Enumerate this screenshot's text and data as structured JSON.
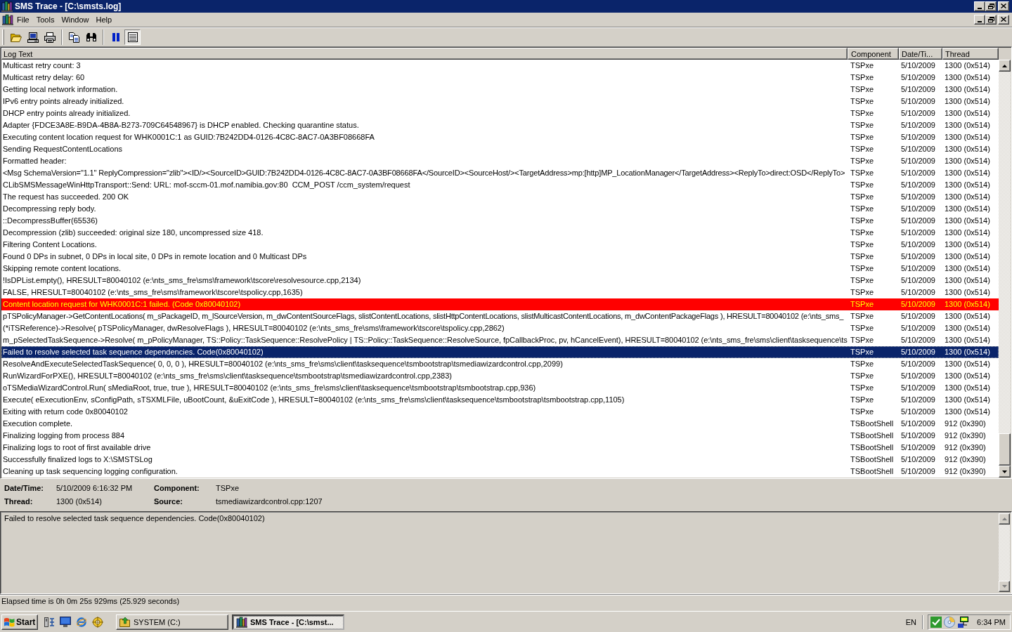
{
  "window": {
    "title": "SMS Trace - [C:\\smsts.log]"
  },
  "menu_bar": {
    "items": [
      "File",
      "Tools",
      "Window",
      "Help"
    ]
  },
  "toolbar": {
    "groups": [
      {
        "buttons": [
          {
            "kind": "open",
            "pressed": false
          },
          {
            "kind": "computer",
            "pressed": false
          },
          {
            "kind": "print",
            "pressed": false
          }
        ]
      },
      {
        "buttons": [
          {
            "kind": "copy",
            "pressed": false
          },
          {
            "kind": "find",
            "pressed": false
          }
        ]
      },
      {
        "buttons": [
          {
            "kind": "pause",
            "pressed": false
          },
          {
            "kind": "list",
            "pressed": true
          }
        ]
      }
    ]
  },
  "log_table": {
    "columns": [
      "Log Text",
      "Component",
      "Date/Ti...",
      "Thread"
    ],
    "rows": [
      {
        "kind": "info",
        "selected": false,
        "log_text": "Multicast retry count: 3",
        "component": "TSPxe",
        "date_time": "5/10/2009",
        "thread": "1300 (0x514)"
      },
      {
        "kind": "info",
        "selected": false,
        "log_text": "Multicast retry delay: 60",
        "component": "TSPxe",
        "date_time": "5/10/2009",
        "thread": "1300 (0x514)"
      },
      {
        "kind": "info",
        "selected": false,
        "log_text": "Getting local network information.",
        "component": "TSPxe",
        "date_time": "5/10/2009",
        "thread": "1300 (0x514)"
      },
      {
        "kind": "info",
        "selected": false,
        "log_text": "IPv6 entry points already initialized.",
        "component": "TSPxe",
        "date_time": "5/10/2009",
        "thread": "1300 (0x514)"
      },
      {
        "kind": "info",
        "selected": false,
        "log_text": "DHCP entry points already initialized.",
        "component": "TSPxe",
        "date_time": "5/10/2009",
        "thread": "1300 (0x514)"
      },
      {
        "kind": "info",
        "selected": false,
        "log_text": "Adapter {FDCE3A8E-B9DA-4B8A-B273-709C64548967} is DHCP enabled. Checking quarantine status.",
        "component": "TSPxe",
        "date_time": "5/10/2009",
        "thread": "1300 (0x514)"
      },
      {
        "kind": "info",
        "selected": false,
        "log_text": "Executing content location request for WHK0001C:1 as GUID:7B242DD4-0126-4C8C-8AC7-0A3BF08668FA",
        "component": "TSPxe",
        "date_time": "5/10/2009",
        "thread": "1300 (0x514)"
      },
      {
        "kind": "info",
        "selected": false,
        "log_text": "Sending RequestContentLocations",
        "component": "TSPxe",
        "date_time": "5/10/2009",
        "thread": "1300 (0x514)"
      },
      {
        "kind": "info",
        "selected": false,
        "log_text": "Formatted header:",
        "component": "TSPxe",
        "date_time": "5/10/2009",
        "thread": "1300 (0x514)"
      },
      {
        "kind": "info",
        "selected": false,
        "log_text": "<Msg SchemaVersion=\"1.1\" ReplyCompression=\"zlib\"><ID/><SourceID>GUID:7B242DD4-0126-4C8C-8AC7-0A3BF08668FA</SourceID><SourceHost/><TargetAddress>mp:[http]MP_LocationManager</TargetAddress><ReplyTo>direct:OSD</ReplyTo>",
        "component": "TSPxe",
        "date_time": "5/10/2009",
        "thread": "1300 (0x514)"
      },
      {
        "kind": "info",
        "selected": false,
        "log_text": "CLibSMSMessageWinHttpTransport::Send: URL: mof-sccm-01.mof.namibia.gov:80  CCM_POST /ccm_system/request",
        "component": "TSPxe",
        "date_time": "5/10/2009",
        "thread": "1300 (0x514)"
      },
      {
        "kind": "info",
        "selected": false,
        "log_text": "The request has succeeded. 200 OK",
        "component": "TSPxe",
        "date_time": "5/10/2009",
        "thread": "1300 (0x514)"
      },
      {
        "kind": "info",
        "selected": false,
        "log_text": "Decompressing reply body.",
        "component": "TSPxe",
        "date_time": "5/10/2009",
        "thread": "1300 (0x514)"
      },
      {
        "kind": "info",
        "selected": false,
        "log_text": "::DecompressBuffer(65536)",
        "component": "TSPxe",
        "date_time": "5/10/2009",
        "thread": "1300 (0x514)"
      },
      {
        "kind": "info",
        "selected": false,
        "log_text": "Decompression (zlib) succeeded: original size 180, uncompressed size 418.",
        "component": "TSPxe",
        "date_time": "5/10/2009",
        "thread": "1300 (0x514)"
      },
      {
        "kind": "info",
        "selected": false,
        "log_text": "Filtering Content Locations.",
        "component": "TSPxe",
        "date_time": "5/10/2009",
        "thread": "1300 (0x514)"
      },
      {
        "kind": "info",
        "selected": false,
        "log_text": "Found 0 DPs in subnet, 0 DPs in local site, 0 DPs in remote location and 0 Multicast DPs",
        "component": "TSPxe",
        "date_time": "5/10/2009",
        "thread": "1300 (0x514)"
      },
      {
        "kind": "info",
        "selected": false,
        "log_text": "Skipping remote content locations.",
        "component": "TSPxe",
        "date_time": "5/10/2009",
        "thread": "1300 (0x514)"
      },
      {
        "kind": "info",
        "selected": false,
        "log_text": "!IsDPList.empty(), HRESULT=80040102 (e:\\nts_sms_fre\\sms\\framework\\tscore\\resolvesource.cpp,2134)",
        "component": "TSPxe",
        "date_time": "5/10/2009",
        "thread": "1300 (0x514)"
      },
      {
        "kind": "info",
        "selected": false,
        "log_text": "FALSE, HRESULT=80040102 (e:\\nts_sms_fre\\sms\\framework\\tscore\\tspolicy.cpp,1635)",
        "component": "TSPxe",
        "date_time": "5/10/2009",
        "thread": "1300 (0x514)"
      },
      {
        "kind": "error",
        "selected": false,
        "log_text": "Content location request for WHK0001C:1 failed. (Code 0x80040102)",
        "component": "TSPxe",
        "date_time": "5/10/2009",
        "thread": "1300 (0x514)"
      },
      {
        "kind": "info",
        "selected": false,
        "log_text": "pTSPolicyManager->GetContentLocations( m_sPackageID, m_lSourceVersion, m_dwContentSourceFlags, slistContentLocations, slistHttpContentLocations, slistMulticastContentLocations, m_dwContentPackageFlags ), HRESULT=80040102 (e:\\nts_sms_",
        "component": "TSPxe",
        "date_time": "5/10/2009",
        "thread": "1300 (0x514)"
      },
      {
        "kind": "info",
        "selected": false,
        "log_text": "(*iTSReference)->Resolve( pTSPolicyManager, dwResolveFlags ), HRESULT=80040102 (e:\\nts_sms_fre\\sms\\framework\\tscore\\tspolicy.cpp,2862)",
        "component": "TSPxe",
        "date_time": "5/10/2009",
        "thread": "1300 (0x514)"
      },
      {
        "kind": "info",
        "selected": false,
        "log_text": "m_pSelectedTaskSequence->Resolve( m_pPolicyManager, TS::Policy::TaskSequence::ResolvePolicy | TS::Policy::TaskSequence::ResolveSource, fpCallbackProc, pv, hCancelEvent), HRESULT=80040102 (e:\\nts_sms_fre\\sms\\client\\tasksequence\\ts",
        "component": "TSPxe",
        "date_time": "5/10/2009",
        "thread": "1300 (0x514)"
      },
      {
        "kind": "info",
        "selected": true,
        "log_text": "Failed to resolve selected task sequence dependencies. Code(0x80040102)",
        "component": "TSPxe",
        "date_time": "5/10/2009",
        "thread": "1300 (0x514)"
      },
      {
        "kind": "info",
        "selected": false,
        "log_text": "ResolveAndExecuteSelectedTaskSequence( 0, 0, 0 ), HRESULT=80040102 (e:\\nts_sms_fre\\sms\\client\\tasksequence\\tsmbootstrap\\tsmediawizardcontrol.cpp,2099)",
        "component": "TSPxe",
        "date_time": "5/10/2009",
        "thread": "1300 (0x514)"
      },
      {
        "kind": "info",
        "selected": false,
        "log_text": "RunWizardForPXE(), HRESULT=80040102 (e:\\nts_sms_fre\\sms\\client\\tasksequence\\tsmbootstrap\\tsmediawizardcontrol.cpp,2383)",
        "component": "TSPxe",
        "date_time": "5/10/2009",
        "thread": "1300 (0x514)"
      },
      {
        "kind": "info",
        "selected": false,
        "log_text": "oTSMediaWizardControl.Run( sMediaRoot, true, true ), HRESULT=80040102 (e:\\nts_sms_fre\\sms\\client\\tasksequence\\tsmbootstrap\\tsmbootstrap.cpp,936)",
        "component": "TSPxe",
        "date_time": "5/10/2009",
        "thread": "1300 (0x514)"
      },
      {
        "kind": "info",
        "selected": false,
        "log_text": "Execute( eExecutionEnv, sConfigPath, sTSXMLFile, uBootCount, &uExitCode ), HRESULT=80040102 (e:\\nts_sms_fre\\sms\\client\\tasksequence\\tsmbootstrap\\tsmbootstrap.cpp,1105)",
        "component": "TSPxe",
        "date_time": "5/10/2009",
        "thread": "1300 (0x514)"
      },
      {
        "kind": "info",
        "selected": false,
        "log_text": "Exiting with return code 0x80040102",
        "component": "TSPxe",
        "date_time": "5/10/2009",
        "thread": "1300 (0x514)"
      },
      {
        "kind": "info",
        "selected": false,
        "log_text": "Execution complete.",
        "component": "TSBootShell",
        "date_time": "5/10/2009",
        "thread": "912 (0x390)"
      },
      {
        "kind": "info",
        "selected": false,
        "log_text": "Finalizing logging from process 884",
        "component": "TSBootShell",
        "date_time": "5/10/2009",
        "thread": "912 (0x390)"
      },
      {
        "kind": "info",
        "selected": false,
        "log_text": "Finalizing logs to root of first available drive",
        "component": "TSBootShell",
        "date_time": "5/10/2009",
        "thread": "912 (0x390)"
      },
      {
        "kind": "info",
        "selected": false,
        "log_text": "Successfully finalized logs to X:\\SMSTSLog",
        "component": "TSBootShell",
        "date_time": "5/10/2009",
        "thread": "912 (0x390)"
      },
      {
        "kind": "info",
        "selected": false,
        "log_text": "Cleaning up task sequencing logging configuration.",
        "component": "TSBootShell",
        "date_time": "5/10/2009",
        "thread": "912 (0x390)"
      }
    ]
  },
  "details": {
    "fields": [
      {
        "label": "Date/Time:",
        "value": "5/10/2009 6:16:32 PM"
      },
      {
        "label": "Component:",
        "value": "TSPxe"
      },
      {
        "label": "Thread:",
        "value": "1300 (0x514)"
      },
      {
        "label": "Source:",
        "value": "tsmediawizardcontrol.cpp:1207"
      }
    ],
    "message": "Failed to resolve selected task sequence dependencies. Code(0x80040102)"
  },
  "status_bar": {
    "text": "Elapsed time is 0h 0m 25s 929ms (25.929 seconds)"
  },
  "taskbar": {
    "start_label": "Start",
    "tasks": [
      {
        "kind": "folder",
        "label": "SYSTEM (C:)",
        "selected": false
      },
      {
        "kind": "app",
        "label": "SMS Trace - [C:\\smst...",
        "selected": true
      }
    ],
    "language": "EN",
    "clock": "6:34 PM"
  }
}
